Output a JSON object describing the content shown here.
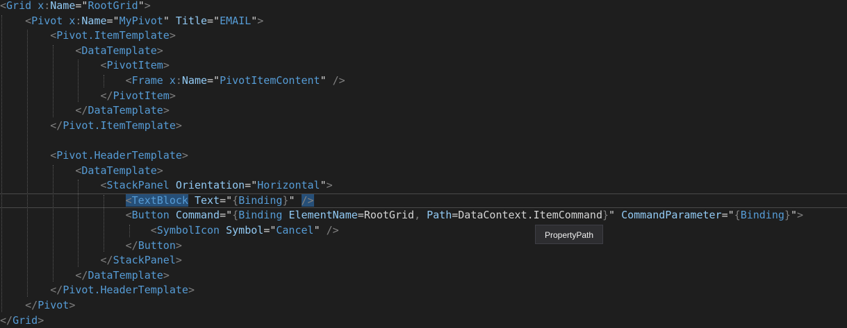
{
  "editor": {
    "tooltip": "PropertyPath"
  },
  "lines": [
    [
      [
        "d",
        "<"
      ],
      [
        "t",
        "Grid"
      ],
      [
        "x",
        " "
      ],
      [
        "p",
        "x"
      ],
      [
        "d",
        ":"
      ],
      [
        "a",
        "Name"
      ],
      [
        "s",
        "=\""
      ],
      [
        "v",
        "RootGrid"
      ],
      [
        "s",
        "\""
      ],
      [
        "d",
        ">"
      ]
    ],
    [
      [
        "x",
        "    "
      ],
      [
        "d",
        "<"
      ],
      [
        "t",
        "Pivot"
      ],
      [
        "x",
        " "
      ],
      [
        "p",
        "x"
      ],
      [
        "d",
        ":"
      ],
      [
        "a",
        "Name"
      ],
      [
        "s",
        "=\""
      ],
      [
        "v",
        "MyPivot"
      ],
      [
        "s",
        "\""
      ],
      [
        "x",
        " "
      ],
      [
        "a",
        "Title"
      ],
      [
        "s",
        "=\""
      ],
      [
        "v",
        "EMAIL"
      ],
      [
        "s",
        "\""
      ],
      [
        "d",
        ">"
      ]
    ],
    [
      [
        "x",
        "        "
      ],
      [
        "d",
        "<"
      ],
      [
        "t",
        "Pivot.ItemTemplate"
      ],
      [
        "d",
        ">"
      ]
    ],
    [
      [
        "x",
        "            "
      ],
      [
        "d",
        "<"
      ],
      [
        "t",
        "DataTemplate"
      ],
      [
        "d",
        ">"
      ]
    ],
    [
      [
        "x",
        "                "
      ],
      [
        "d",
        "<"
      ],
      [
        "t",
        "PivotItem"
      ],
      [
        "d",
        ">"
      ]
    ],
    [
      [
        "x",
        "                    "
      ],
      [
        "d",
        "<"
      ],
      [
        "t",
        "Frame"
      ],
      [
        "x",
        " "
      ],
      [
        "p",
        "x"
      ],
      [
        "d",
        ":"
      ],
      [
        "a",
        "Name"
      ],
      [
        "s",
        "=\""
      ],
      [
        "v",
        "PivotItemContent"
      ],
      [
        "s",
        "\""
      ],
      [
        "x",
        " "
      ],
      [
        "d",
        "/>"
      ]
    ],
    [
      [
        "x",
        "                "
      ],
      [
        "d",
        "</"
      ],
      [
        "t",
        "PivotItem"
      ],
      [
        "d",
        ">"
      ]
    ],
    [
      [
        "x",
        "            "
      ],
      [
        "d",
        "</"
      ],
      [
        "t",
        "DataTemplate"
      ],
      [
        "d",
        ">"
      ]
    ],
    [
      [
        "x",
        "        "
      ],
      [
        "d",
        "</"
      ],
      [
        "t",
        "Pivot.ItemTemplate"
      ],
      [
        "d",
        ">"
      ]
    ],
    [],
    [
      [
        "x",
        "        "
      ],
      [
        "d",
        "<"
      ],
      [
        "t",
        "Pivot.HeaderTemplate"
      ],
      [
        "d",
        ">"
      ]
    ],
    [
      [
        "x",
        "            "
      ],
      [
        "d",
        "<"
      ],
      [
        "t",
        "DataTemplate"
      ],
      [
        "d",
        ">"
      ]
    ],
    [
      [
        "x",
        "                "
      ],
      [
        "d",
        "<"
      ],
      [
        "t",
        "StackPanel"
      ],
      [
        "x",
        " "
      ],
      [
        "a",
        "Orientation"
      ],
      [
        "s",
        "=\""
      ],
      [
        "v",
        "Horizontal"
      ],
      [
        "s",
        "\""
      ],
      [
        "d",
        ">"
      ]
    ],
    [
      [
        "x",
        "                    "
      ],
      [
        "d sel",
        "<"
      ],
      [
        "t sel",
        "TextBlock"
      ],
      [
        "x",
        " "
      ],
      [
        "a",
        "Text"
      ],
      [
        "s",
        "=\""
      ],
      [
        "d",
        "{"
      ],
      [
        "t",
        "Binding"
      ],
      [
        "d",
        "}"
      ],
      [
        "s",
        "\""
      ],
      [
        "x",
        " "
      ],
      [
        "d sel",
        "/>"
      ]
    ],
    [
      [
        "x",
        "                    "
      ],
      [
        "d",
        "<"
      ],
      [
        "t",
        "Button"
      ],
      [
        "x",
        " "
      ],
      [
        "a",
        "Command"
      ],
      [
        "s",
        "=\""
      ],
      [
        "d",
        "{"
      ],
      [
        "t",
        "Binding"
      ],
      [
        "x",
        " "
      ],
      [
        "a",
        "ElementName"
      ],
      [
        "s",
        "="
      ],
      [
        "x",
        "RootGrid"
      ],
      [
        "d",
        ","
      ],
      [
        "x",
        " "
      ],
      [
        "a",
        "Path"
      ],
      [
        "s",
        "="
      ],
      [
        "x",
        "DataContext.ItemCommand"
      ],
      [
        "d",
        "}"
      ],
      [
        "s",
        "\""
      ],
      [
        "x",
        " "
      ],
      [
        "a",
        "CommandParameter"
      ],
      [
        "s",
        "=\""
      ],
      [
        "d",
        "{"
      ],
      [
        "t",
        "Binding"
      ],
      [
        "d",
        "}"
      ],
      [
        "s",
        "\""
      ],
      [
        "d",
        ">"
      ]
    ],
    [
      [
        "x",
        "                        "
      ],
      [
        "d",
        "<"
      ],
      [
        "t",
        "SymbolIcon"
      ],
      [
        "x",
        " "
      ],
      [
        "a",
        "Symbol"
      ],
      [
        "s",
        "=\""
      ],
      [
        "v",
        "Cancel"
      ],
      [
        "s",
        "\""
      ],
      [
        "x",
        " "
      ],
      [
        "d",
        "/>"
      ]
    ],
    [
      [
        "x",
        "                    "
      ],
      [
        "d",
        "</"
      ],
      [
        "t",
        "Button"
      ],
      [
        "d",
        ">"
      ]
    ],
    [
      [
        "x",
        "                "
      ],
      [
        "d",
        "</"
      ],
      [
        "t",
        "StackPanel"
      ],
      [
        "d",
        ">"
      ]
    ],
    [
      [
        "x",
        "            "
      ],
      [
        "d",
        "</"
      ],
      [
        "t",
        "DataTemplate"
      ],
      [
        "d",
        ">"
      ]
    ],
    [
      [
        "x",
        "        "
      ],
      [
        "d",
        "</"
      ],
      [
        "t",
        "Pivot.HeaderTemplate"
      ],
      [
        "d",
        ">"
      ]
    ],
    [
      [
        "x",
        "    "
      ],
      [
        "d",
        "</"
      ],
      [
        "t",
        "Pivot"
      ],
      [
        "d",
        ">"
      ]
    ],
    [
      [
        "d",
        "</"
      ],
      [
        "t",
        "Grid"
      ],
      [
        "d",
        ">"
      ]
    ]
  ]
}
